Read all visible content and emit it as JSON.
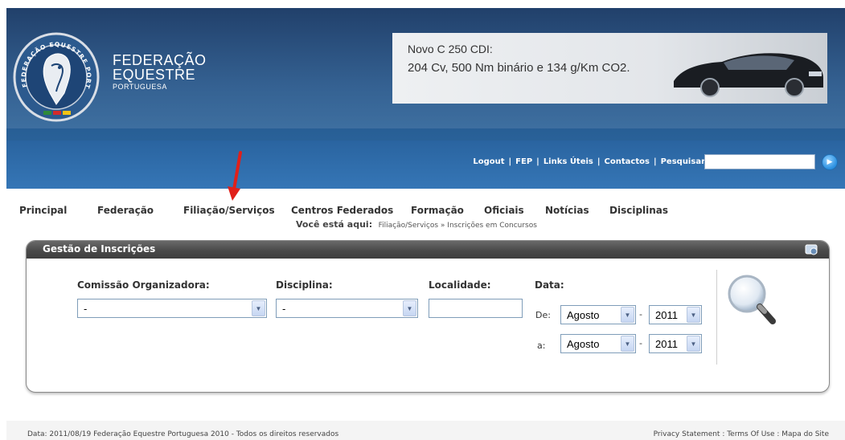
{
  "header": {
    "brand": {
      "line1": "FEDERAÇÃO",
      "line2": "EQUESTRE",
      "line3": "PORTUGUESA"
    },
    "seal_text": "FEDERAÇÃO EQUESTRE PORTUGUESA",
    "ad": {
      "line1": "Novo C 250 CDI:",
      "line2": "204 Cv, 500 Nm binário e 134 g/Km CO2."
    },
    "top_links": [
      "Logout",
      "FEP",
      "Links Úteis",
      "Contactos"
    ],
    "separator": "|",
    "search_label": "Pesquisar:",
    "search_value": ""
  },
  "nav": {
    "items": [
      "Principal",
      "Federação",
      "Filiação/Serviços",
      "Centros Federados",
      "Formação",
      "Oficiais",
      "Notícias",
      "Disciplinas"
    ]
  },
  "breadcrumb": {
    "label": "Você está aqui:",
    "path": "Filiação/Serviços » Inscrições em Concursos"
  },
  "panel": {
    "title": "Gestão de Inscrições",
    "fields": {
      "comissao": {
        "label": "Comissão Organizadora:",
        "value": "-"
      },
      "disciplina": {
        "label": "Disciplina:",
        "value": "-"
      },
      "localidade": {
        "label": "Localidade:",
        "value": ""
      },
      "data": {
        "label": "Data:",
        "de_label": "De:",
        "a_label": "a:",
        "de_month": "Agosto",
        "de_year": "2011",
        "a_month": "Agosto",
        "a_year": "2011",
        "dash": "-"
      }
    }
  },
  "footer": {
    "left": "Data: 2011/08/19   Federação Equestre Portuguesa 2010 - Todos os direitos reservados",
    "right": "Privacy Statement : Terms Of Use : Mapa do Site"
  },
  "colors": {
    "header_dark": "#1a3a66",
    "header_light": "#3576b6",
    "panel_head": "#4a4a4a",
    "arrow": "#e0201a"
  }
}
